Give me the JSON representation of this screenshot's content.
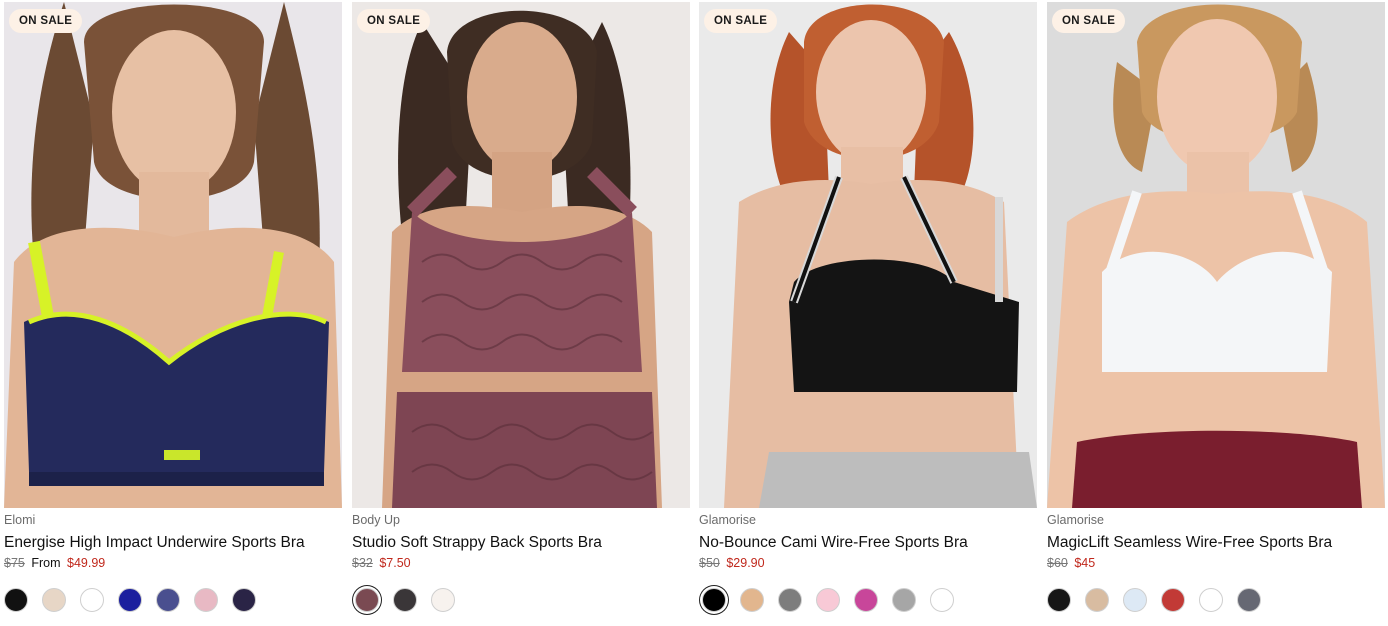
{
  "products": [
    {
      "badge": "ON SALE",
      "brand": "Elomi",
      "title": "Energise High Impact Underwire Sports Bra",
      "price_original": "$75",
      "price_prefix": "From",
      "price_sale": "$49.99",
      "swatches": [
        "#111111",
        "#e7d6c6",
        "#ffffff",
        "#1b1f9e",
        "#4a4f8f",
        "#e8b9c4",
        "#2a2446"
      ],
      "selected_swatch": null
    },
    {
      "badge": "ON SALE",
      "brand": "Body Up",
      "title": "Studio Soft Strappy Back Sports Bra",
      "price_original": "$32",
      "price_prefix": "",
      "price_sale": "$7.50",
      "swatches": [
        "#7a4a52",
        "#3a3638",
        "#f7f2ee"
      ],
      "selected_swatch": 0
    },
    {
      "badge": "ON SALE",
      "brand": "Glamorise",
      "title": "No-Bounce Cami Wire-Free Sports Bra",
      "price_original": "$50",
      "price_prefix": "",
      "price_sale": "$29.90",
      "swatches": [
        "#000000",
        "#e2b68e",
        "#7d7d7d",
        "#f8c9d6",
        "#c8469a",
        "#a6a6a6",
        "#ffffff"
      ],
      "selected_swatch": 0
    },
    {
      "badge": "ON SALE",
      "brand": "Glamorise",
      "title": "MagicLift Seamless Wire-Free Sports Bra",
      "price_original": "$60",
      "price_prefix": "",
      "price_sale": "$45",
      "swatches": [
        "#161616",
        "#d8bca1",
        "#dde9f5",
        "#c23a36",
        "#ffffff",
        "#666873"
      ],
      "selected_swatch": null
    }
  ],
  "colors": {
    "badge_bg": "#fdf1e6",
    "sale_red": "#c0281c",
    "old_price_gray": "#777777"
  }
}
